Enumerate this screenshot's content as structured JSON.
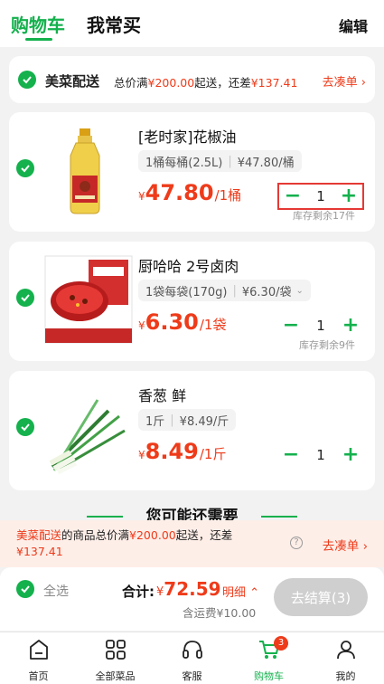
{
  "header": {
    "tabs": [
      "购物车",
      "我常买"
    ],
    "edit_label": "编辑"
  },
  "delivery": {
    "title": "美菜配送",
    "text_prefix": "总价满",
    "threshold": "¥200.00",
    "text_mid": "起送，还差",
    "diff": "¥137.41",
    "link_label": "去凑单"
  },
  "items": [
    {
      "name": "[老时家]花椒油",
      "spec": "1桶每桶(2.5L)",
      "unit_price": "¥47.80/桶",
      "price_symbol": "¥",
      "price": "47.80",
      "price_unit": "/1桶",
      "qty": "1",
      "stock": "库存剩余17件"
    },
    {
      "name": "厨哈哈 2号卤肉",
      "spec": "1袋每袋(170g)",
      "unit_price": "¥6.30/袋",
      "price_symbol": "¥",
      "price": "6.30",
      "price_unit": "/1袋",
      "qty": "1",
      "stock": "库存剩余9件"
    },
    {
      "name": "香葱 鲜",
      "spec": "1斤",
      "unit_price": "¥8.49/斤",
      "price_symbol": "¥",
      "price": "8.49",
      "price_unit": "/1斤",
      "qty": "1",
      "stock": ""
    }
  ],
  "suggest_title": "您可能还需要",
  "banner": {
    "link_text": "美菜配送",
    "text_a": "的商品总价满",
    "threshold": "¥200.00",
    "text_b": "起送，还差",
    "diff": "¥137.41",
    "link_label": "去凑单"
  },
  "footer": {
    "select_all_label": "全选",
    "total_label": "合计:",
    "total_symbol": "¥",
    "total_value": "72.59",
    "detail_label": "明细",
    "shipping_label": "含运费¥10.00",
    "checkout_label": "去结算(3)"
  },
  "tabbar": [
    {
      "label": "首页",
      "icon": "home-icon"
    },
    {
      "label": "全部菜品",
      "icon": "grid-icon"
    },
    {
      "label": "客服",
      "icon": "headset-icon"
    },
    {
      "label": "购物车",
      "icon": "cart-icon",
      "badge": "3",
      "active": true
    },
    {
      "label": "我的",
      "icon": "person-icon"
    }
  ],
  "colors": {
    "accent": "#14b14d",
    "price": "#ee3b1a",
    "highlight_border": "#e53935"
  }
}
